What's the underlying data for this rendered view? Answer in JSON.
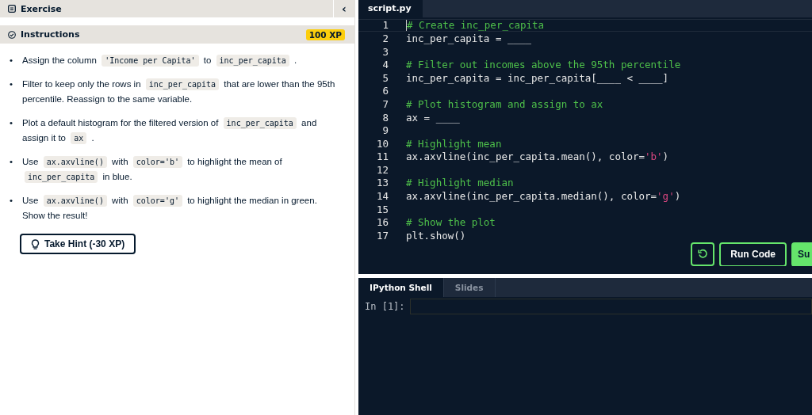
{
  "exercise_header": {
    "title": "Exercise",
    "collapse": "‹"
  },
  "instructions": {
    "title": "Instructions",
    "xp": "100 XP",
    "items": [
      {
        "bullet": "•",
        "parts": [
          {
            "kind": "text",
            "text": "Assign the column"
          },
          {
            "kind": "code",
            "text": "'Income per Capita'"
          },
          {
            "kind": "text",
            "text": "to"
          },
          {
            "kind": "code",
            "text": "inc_per_capita"
          },
          {
            "kind": "text",
            "text": "."
          }
        ]
      },
      {
        "bullet": "•",
        "parts": [
          {
            "kind": "text",
            "text": "Filter to keep only the rows in"
          },
          {
            "kind": "code",
            "text": "inc_per_capita"
          },
          {
            "kind": "text",
            "text": "that are lower than the 95th percentile. Reassign to the same variable."
          }
        ]
      },
      {
        "bullet": "•",
        "parts": [
          {
            "kind": "text",
            "text": "Plot a default histogram for the filtered version of"
          },
          {
            "kind": "code",
            "text": "inc_per_capita"
          },
          {
            "kind": "text",
            "text": "and assign it to"
          },
          {
            "kind": "code",
            "text": "ax"
          },
          {
            "kind": "text",
            "text": "."
          }
        ]
      },
      {
        "bullet": "•",
        "parts": [
          {
            "kind": "text",
            "text": "Use"
          },
          {
            "kind": "code",
            "text": "ax.axvline()"
          },
          {
            "kind": "text",
            "text": "with"
          },
          {
            "kind": "code",
            "text": "color='b'"
          },
          {
            "kind": "text",
            "text": "to highlight the mean of"
          },
          {
            "kind": "code",
            "text": "inc_per_capita"
          },
          {
            "kind": "text",
            "text": "in blue."
          }
        ]
      },
      {
        "bullet": "•",
        "parts": [
          {
            "kind": "text",
            "text": "Use"
          },
          {
            "kind": "code",
            "text": "ax.axvline()"
          },
          {
            "kind": "text",
            "text": "with"
          },
          {
            "kind": "code",
            "text": "color='g'"
          },
          {
            "kind": "text",
            "text": "to highlight the median in green. Show the result!"
          }
        ]
      }
    ],
    "hint_button": "Take Hint (-30 XP)"
  },
  "editor": {
    "tab": "script.py",
    "lines": [
      {
        "number": "1",
        "active": true,
        "tokens": [
          {
            "kind": "comment",
            "text": "# Create inc_per_capita"
          }
        ]
      },
      {
        "number": "2",
        "active": false,
        "tokens": [
          {
            "kind": "plain",
            "text": "inc_per_capita = ____"
          }
        ]
      },
      {
        "number": "3",
        "active": false
      },
      {
        "number": "4",
        "active": false,
        "tokens": [
          {
            "kind": "comment",
            "text": "# Filter out incomes above the 95th percentile"
          }
        ]
      },
      {
        "number": "5",
        "active": false,
        "tokens": [
          {
            "kind": "plain",
            "text": "inc_per_capita = inc_per_capita[____ < ____]"
          }
        ]
      },
      {
        "number": "6",
        "active": false
      },
      {
        "number": "7",
        "active": false,
        "tokens": [
          {
            "kind": "comment",
            "text": "# Plot histogram and assign to ax"
          }
        ]
      },
      {
        "number": "8",
        "active": false,
        "tokens": [
          {
            "kind": "plain",
            "text": "ax = ____"
          }
        ]
      },
      {
        "number": "9",
        "active": false
      },
      {
        "number": "10",
        "active": false,
        "tokens": [
          {
            "kind": "comment",
            "text": "# Highlight mean"
          }
        ]
      },
      {
        "number": "11",
        "active": false,
        "tokens": [
          {
            "kind": "plain",
            "text": "ax.axvline(inc_per_capita.mean(), color="
          },
          {
            "kind": "string",
            "text": "'b'"
          },
          {
            "kind": "plain",
            "text": ")"
          }
        ]
      },
      {
        "number": "12",
        "active": false
      },
      {
        "number": "13",
        "active": false,
        "tokens": [
          {
            "kind": "comment",
            "text": "# Highlight median"
          }
        ]
      },
      {
        "number": "14",
        "active": false,
        "tokens": [
          {
            "kind": "plain",
            "text": "ax.axvline(inc_per_capita.median(), color="
          },
          {
            "kind": "string",
            "text": "'g'"
          },
          {
            "kind": "plain",
            "text": ")"
          }
        ]
      },
      {
        "number": "15",
        "active": false
      },
      {
        "number": "16",
        "active": false,
        "tokens": [
          {
            "kind": "comment",
            "text": "# Show the plot"
          }
        ]
      },
      {
        "number": "17",
        "active": false,
        "tokens": [
          {
            "kind": "plain",
            "text": "plt.show()"
          }
        ]
      }
    ],
    "run_button": "Run Code",
    "submit_button": "Su"
  },
  "console": {
    "tabs": [
      {
        "label": "IPython Shell",
        "selected": true
      },
      {
        "label": "Slides",
        "selected": false
      }
    ],
    "prompt": "In [1]:"
  }
}
